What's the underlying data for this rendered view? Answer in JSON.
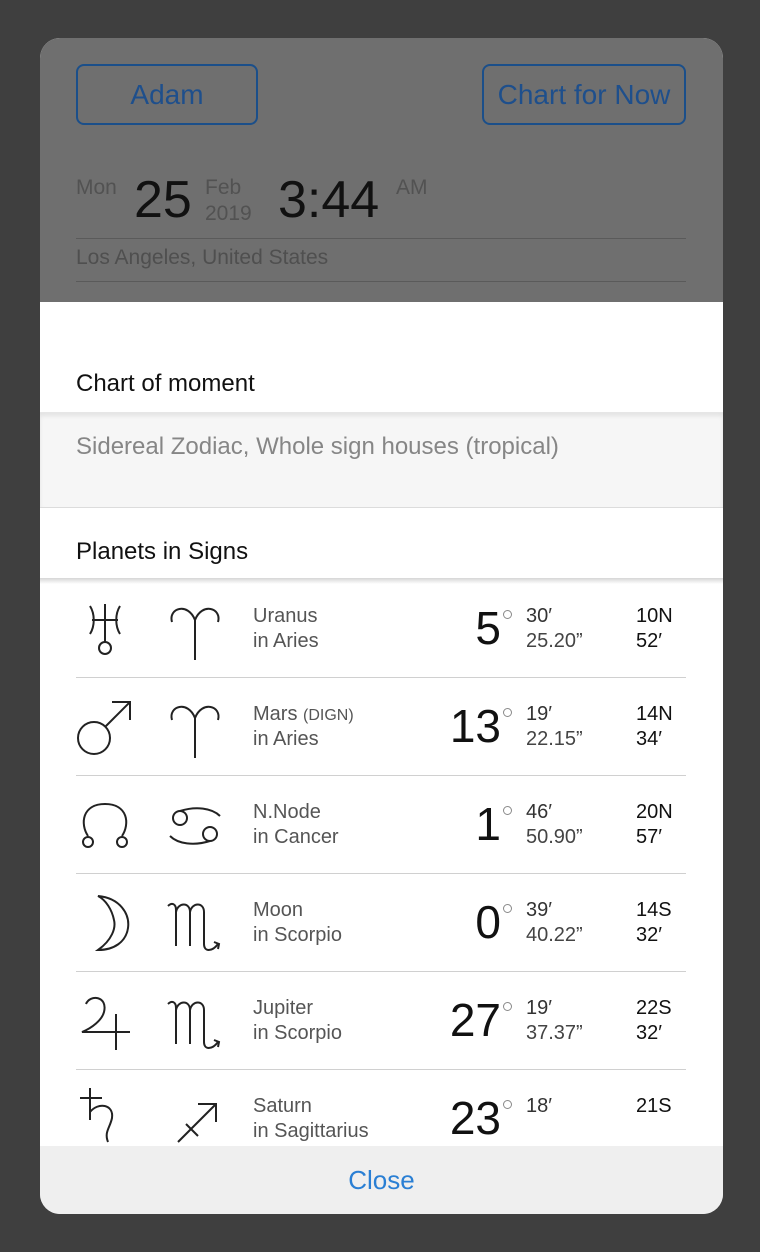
{
  "header": {
    "person_button": "Adam",
    "now_button": "Chart for Now",
    "weekday": "Mon",
    "day": "25",
    "month": "Feb",
    "year": "2019",
    "time": "3:44",
    "ampm": "AM",
    "location": "Los Angeles, United States"
  },
  "sheet": {
    "title": "Chart of moment",
    "zodiac": "Sidereal Zodiac, Whole sign houses (tropical)",
    "section_title": "Planets in Signs",
    "close_label": "Close"
  },
  "planets": [
    {
      "planet_icon": "uranus-icon",
      "sign_icon": "aries-icon",
      "name": "Uranus",
      "dign": "",
      "sign": "in Aries",
      "deg": "5",
      "min": "30′",
      "sec": "25.20”",
      "lat": "10N",
      "lat_min": "52′"
    },
    {
      "planet_icon": "mars-icon",
      "sign_icon": "aries-icon",
      "name": "Mars",
      "dign": "(DIGN)",
      "sign": "in Aries",
      "deg": "13",
      "min": "19′",
      "sec": "22.15”",
      "lat": "14N",
      "lat_min": "34′"
    },
    {
      "planet_icon": "north-node-icon",
      "sign_icon": "cancer-icon",
      "name": "N.Node",
      "dign": "",
      "sign": "in Cancer",
      "deg": "1",
      "min": "46′",
      "sec": "50.90”",
      "lat": "20N",
      "lat_min": "57′"
    },
    {
      "planet_icon": "moon-icon",
      "sign_icon": "scorpio-icon",
      "name": "Moon",
      "dign": "",
      "sign": "in Scorpio",
      "deg": "0",
      "min": "39′",
      "sec": "40.22”",
      "lat": "14S",
      "lat_min": "32′"
    },
    {
      "planet_icon": "jupiter-icon",
      "sign_icon": "scorpio-icon",
      "name": "Jupiter",
      "dign": "",
      "sign": "in Scorpio",
      "deg": "27",
      "min": "19′",
      "sec": "37.37”",
      "lat": "22S",
      "lat_min": "32′"
    },
    {
      "planet_icon": "saturn-icon",
      "sign_icon": "sagittarius-icon",
      "name": "Saturn",
      "dign": "",
      "sign": "in Sagittarius",
      "deg": "23",
      "min": "18′",
      "sec": "",
      "lat": "21S",
      "lat_min": ""
    }
  ]
}
